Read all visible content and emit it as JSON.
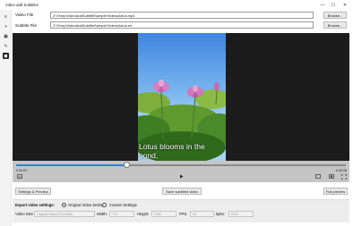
{
  "window": {
    "title": "Video add Subtitles",
    "minimize_glyph": "—",
    "maximize_glyph": "☐",
    "close_glyph": "✕"
  },
  "nav": {
    "items": [
      {
        "icon": "hamburger-menu-icon",
        "glyph": "≡"
      },
      {
        "icon": "add-icon",
        "glyph": "+"
      },
      {
        "icon": "video-subtitle-icon",
        "glyph": "▣"
      },
      {
        "icon": "pencil-icon",
        "glyph": "✎"
      },
      {
        "icon": "subtitle-tool-icon",
        "glyph": "◼"
      }
    ]
  },
  "files": {
    "video_label": "Video File",
    "video_path": "Z:\\Temp\\VideoAddSubtitleSample\\Videos\\lotus.mp4",
    "subtitle_label": "Subtitle File",
    "subtitle_path": "Z:\\Temp\\VideoAddSubtitleSample\\Videos\\lotus.srt",
    "browse_label": "Browse..."
  },
  "player": {
    "subtitle_line1": "Lotus blooms in the",
    "subtitle_line2": "pond,",
    "progress": 0.335,
    "current_time": "0:00:02",
    "total_time": "0:00:06",
    "icons": {
      "captions": "captions-icon",
      "play": "play-icon",
      "cast": "cast-icon",
      "aspect": "aspect-ratio-icon",
      "fullscreen": "fullscreen-icon"
    }
  },
  "actions": {
    "settings_preview": "Settings & Preview",
    "save_video": "Save subtitled video",
    "full_preview": "Full preview"
  },
  "export": {
    "heading": "Export video settings:",
    "option_original": "Original Video Settings",
    "option_custom": "Custom Settings",
    "selected": "original",
    "video_size_label": "Video Size",
    "video_size_value": "Original video(720x1280)",
    "width_label": "Width:",
    "width_value": "720",
    "height_label": "Height:",
    "height_value": "1280",
    "fps_label": "FPS:",
    "fps_value": "30",
    "kbits_label": "kpbs:",
    "kbits_value": "2000"
  },
  "colors": {
    "accent": "#2f7fd8",
    "player_bg": "#1c1c1c",
    "controls_bg": "#c5c5c5"
  }
}
